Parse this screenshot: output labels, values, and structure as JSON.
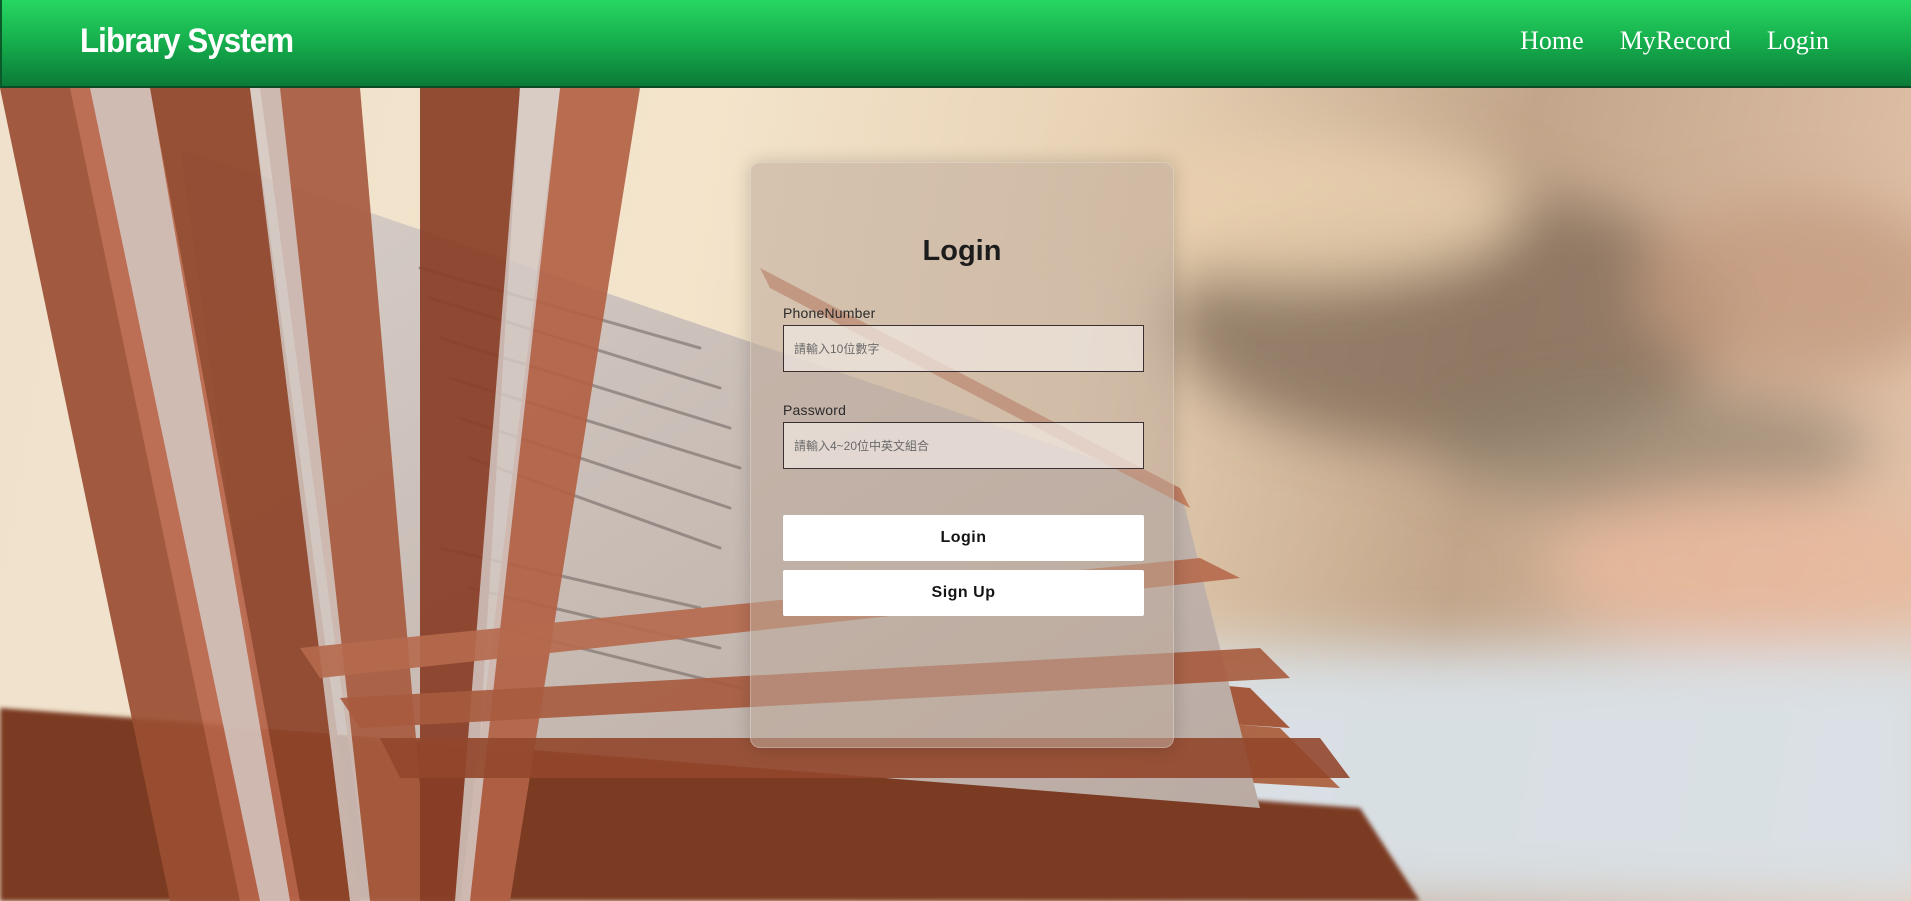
{
  "header": {
    "brand": "Library System",
    "nav": [
      "Home",
      "MyRecord",
      "Login"
    ]
  },
  "login_form": {
    "title": "Login",
    "phone": {
      "label": "PhoneNumber",
      "placeholder": "請輸入10位數字",
      "value": ""
    },
    "password": {
      "label": "Password",
      "placeholder": "請輸入4~20位中英文組合",
      "value": ""
    },
    "login_button": "Login",
    "signup_button": "Sign Up"
  },
  "colors": {
    "header_top": "#27d762",
    "header_bottom": "#0b7a38",
    "card_bg": "rgba(190,170,155,0.55)",
    "button_bg": "#ffffff"
  },
  "icons": [
    "open-book-background-image"
  ]
}
